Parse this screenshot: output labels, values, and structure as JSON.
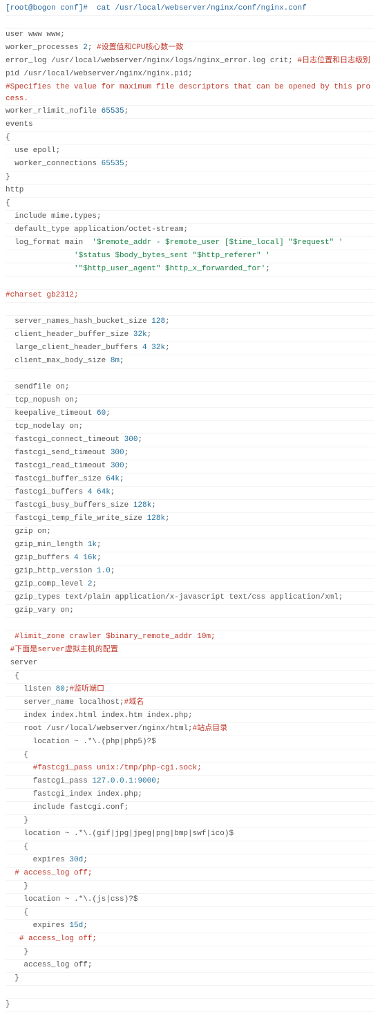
{
  "head": {
    "prompt": "[root@bogon conf]#  cat /usr/local/webserver/nginx/conf/nginx.conf"
  },
  "l01": "user www www;",
  "l02a": "worker_processes ",
  "l02b": "2",
  "l02c": "; ",
  "l02d": "#设置值和CPU核心数一致",
  "l03a": "error_log /usr/local/webserver/nginx/logs/nginx_error.log crit; ",
  "l03b": "#日志位置和日志级别",
  "l04": "pid /usr/local/webserver/nginx/nginx.pid;",
  "l05": "#Specifies the value for maximum file descriptors that can be opened by this process.",
  "l06a": "worker_rlimit_nofile ",
  "l06b": "65535",
  "l06c": ";",
  "l07": "events",
  "l08": "{",
  "l09": "  use epoll;",
  "l10a": "  worker_connections ",
  "l10b": "65535",
  "l10c": ";",
  "l11": "}",
  "l12": "http",
  "l13": "{",
  "l14": "  include mime.types;",
  "l15": "  default_type application/octet-stream;",
  "l16a": "  log_format main  ",
  "l16b": "'$remote_addr - $remote_user [$time_local] \"$request\" '",
  "l17a": "               ",
  "l17b": "'$status $body_bytes_sent \"$http_referer\" '",
  "l18a": "               ",
  "l18b": "'\"$http_user_agent\" $http_x_forwarded_for'",
  "l18c": ";",
  "l19": "#charset gb2312;",
  "l20a": "  server_names_hash_bucket_size ",
  "l20b": "128",
  "l20c": ";",
  "l21a": "  client_header_buffer_size ",
  "l21b": "32k",
  "l21c": ";",
  "l22a": "  large_client_header_buffers ",
  "l22b": "4",
  "l22c": " ",
  "l22d": "32k",
  "l22e": ";",
  "l23a": "  client_max_body_size ",
  "l23b": "8m",
  "l23c": ";",
  "l24": "  sendfile on;",
  "l25": "  tcp_nopush on;",
  "l26a": "  keepalive_timeout ",
  "l26b": "60",
  "l26c": ";",
  "l27": "  tcp_nodelay on;",
  "l28a": "  fastcgi_connect_timeout ",
  "l28b": "300",
  "l28c": ";",
  "l29a": "  fastcgi_send_timeout ",
  "l29b": "300",
  "l29c": ";",
  "l30a": "  fastcgi_read_timeout ",
  "l30b": "300",
  "l30c": ";",
  "l31a": "  fastcgi_buffer_size ",
  "l31b": "64k",
  "l31c": ";",
  "l32a": "  fastcgi_buffers ",
  "l32b": "4",
  "l32c": " ",
  "l32d": "64k",
  "l32e": ";",
  "l33a": "  fastcgi_busy_buffers_size ",
  "l33b": "128k",
  "l33c": ";",
  "l34a": "  fastcgi_temp_file_write_size ",
  "l34b": "128k",
  "l34c": ";",
  "l35": "  gzip on;",
  "l36a": "  gzip_min_length ",
  "l36b": "1k",
  "l36c": ";",
  "l37a": "  gzip_buffers ",
  "l37b": "4",
  "l37c": " ",
  "l37d": "16k",
  "l37e": ";",
  "l38a": "  gzip_http_version ",
  "l38b": "1.0",
  "l38c": ";",
  "l39a": "  gzip_comp_level ",
  "l39b": "2",
  "l39c": ";",
  "l40": "  gzip_types text/plain application/x-javascript text/css application/xml;",
  "l41": "  gzip_vary on;",
  "l42a": "  ",
  "l42b": "#limit_zone crawler $binary_remote_addr 10m;",
  "l43a": " ",
  "l43b": "#下面是server虚拟主机的配置",
  "l44": " server",
  "l45": "  {",
  "l46a": "    listen ",
  "l46b": "80",
  "l46c": ";",
  "l46d": "#监听端口",
  "l47a": "    server_name localhost;",
  "l47b": "#域名",
  "l48": "    index index.html index.htm index.php;",
  "l49a": "    root /usr/local/webserver/nginx/html;",
  "l49b": "#站点目录",
  "l50": "      location ~ .*\\.(php|php5)?$",
  "l51": "    {",
  "l52a": "      ",
  "l52b": "#fastcgi_pass unix:/tmp/php-cgi.sock;",
  "l53a": "      fastcgi_pass ",
  "l53b": "127.0.0.1:9000",
  "l53c": ";",
  "l54": "      fastcgi_index index.php;",
  "l55": "      include fastcgi.conf;",
  "l56": "    }",
  "l57": "    location ~ .*\\.(gif|jpg|jpeg|png|bmp|swf|ico)$",
  "l58": "    {",
  "l59a": "      expires ",
  "l59b": "30d",
  "l59c": ";",
  "l60": "  # access_log off;",
  "l61": "    }",
  "l62": "    location ~ .*\\.(js|css)?$",
  "l63": "    {",
  "l64a": "      expires ",
  "l64b": "15d",
  "l64c": ";",
  "l65": "   # access_log off;",
  "l66": "    }",
  "l67": "    access_log off;",
  "l68": "  }",
  "l69": "}"
}
